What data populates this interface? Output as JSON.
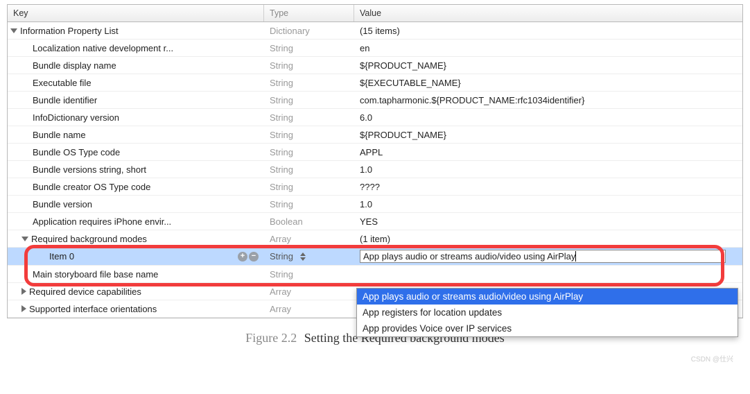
{
  "headers": {
    "key": "Key",
    "type": "Type",
    "value": "Value"
  },
  "root": {
    "key": "Information Property List",
    "type": "Dictionary",
    "value": "(15 items)"
  },
  "rows": [
    {
      "key": "Localization native development r...",
      "type": "String",
      "value": "en"
    },
    {
      "key": "Bundle display name",
      "type": "String",
      "value": "${PRODUCT_NAME}"
    },
    {
      "key": "Executable file",
      "type": "String",
      "value": "${EXECUTABLE_NAME}"
    },
    {
      "key": "Bundle identifier",
      "type": "String",
      "value": "com.tapharmonic.${PRODUCT_NAME:rfc1034identifier}"
    },
    {
      "key": "InfoDictionary version",
      "type": "String",
      "value": "6.0"
    },
    {
      "key": "Bundle name",
      "type": "String",
      "value": "${PRODUCT_NAME}"
    },
    {
      "key": "Bundle OS Type code",
      "type": "String",
      "value": "APPL"
    },
    {
      "key": "Bundle versions string, short",
      "type": "String",
      "value": "1.0"
    },
    {
      "key": "Bundle creator OS Type code",
      "type": "String",
      "value": "????"
    },
    {
      "key": "Bundle version",
      "type": "String",
      "value": "1.0"
    },
    {
      "key": "Application requires iPhone envir...",
      "type": "Boolean",
      "value": "YES"
    }
  ],
  "bgmodes": {
    "key": "Required background modes",
    "type": "Array",
    "value": "(1 item)"
  },
  "item0": {
    "key": "Item 0",
    "type": "String",
    "value": "App plays audio or streams audio/video using AirPlay"
  },
  "tail": [
    {
      "key": "Main storyboard file base name",
      "type": "String",
      "value": ""
    },
    {
      "key": "Required device capabilities",
      "type": "Array",
      "value": "",
      "collapsed": true
    },
    {
      "key": "Supported interface orientations",
      "type": "Array",
      "value": "",
      "collapsed": true
    }
  ],
  "dropdown": [
    "App plays audio or streams audio/video using AirPlay",
    "App registers for location updates",
    "App provides Voice over IP services"
  ],
  "caption": {
    "label": "Figure 2.2",
    "text": "Setting the Required background modes"
  },
  "watermark": "CSDN @仕兴"
}
